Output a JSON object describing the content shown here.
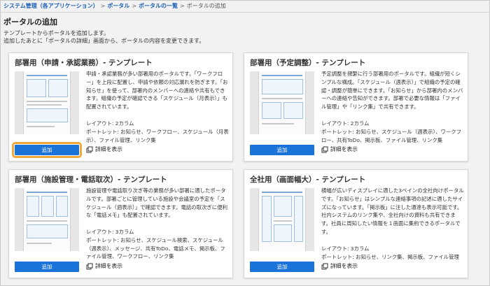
{
  "breadcrumb": {
    "items": [
      "システム管理（各アプリケーション）",
      "ポータル",
      "ポータルの一覧"
    ],
    "separator": ">",
    "current": "ポータルの追加"
  },
  "page": {
    "title": "ポータルの追加",
    "desc_line1": "テンプレートからポータルを追加します。",
    "desc_line2": "追加したあとに「ポータルの詳細」画面から、ポータルの内容を変更できます。"
  },
  "cards": [
    {
      "title": "部署用（申請・承認業務）- テンプレート",
      "description": "申請・承認業務が多い部署用のポータルです。「ワークフロー」を上段に配置し、申請や依頼の対応漏れを防ぎます。「お知らせ」を使って、部署内のメンバーへの連絡や共有もできます。組織の予定が確認できる「スケジュール（月表示）」も配置されています。",
      "layout": "レイアウト: 2カラム",
      "portlets": "ポートレット: お知らせ、ワークフロー、スケジュール（月表示）、ファイル管理、リンク集",
      "add_label": "追加",
      "detail_label": "詳細を表示"
    },
    {
      "title": "部署用（予定調整）- テンプレート",
      "description": "予定調整を頻繁に行う部署用のポータルです。組織が短くシンプルな構成。「スケジュール（週表示）」で組織の予定の確認・調整が簡単にできます。「お知らせ」から部署内のメンバーへの連絡や告知ができます。部署で必要な情報は「ファイル管理」や「リンク集」で共有できます。",
      "layout": "レイアウト: 2カラム",
      "portlets": "ポートレット: お知らせ、スケジュール（週表示）、ワークフロー、共有ToDo、掲示板、ファイル管理、リンク集",
      "add_label": "追加",
      "detail_label": "詳細を表示"
    },
    {
      "title": "部署用（施設管理・電話取次）- テンプレート",
      "description": "施設管理や電話取り次ぎ等の業務が多い部署に適したポータルです。部署ごとに管理している施設や会議室の予定を「スケジュール（週表示）」で確認できます。電話の取次ぎに便利な「電話メモ」も配置されています。",
      "layout": "レイアウト: 3カラム",
      "portlets": "ポートレット: お知らせ、スケジュール検索、スケジュール（週表示）、メッセージ、共有ToDo、電話メモ、掲示板、ファイル管理、ワークフロー、リンク集",
      "add_label": "追加",
      "detail_label": "詳細を表示"
    },
    {
      "title": "全社用（画面幅大）- テンプレート",
      "description": "横幅が広いディスプレイに適した3ペインの全社向けポータルです。「お知らせ」はシンプルな連絡事項の記述に適したサイズになっています。「掲示板」に注した通達も表示可能です。社内システムのリンク集や、全社向けの資料も共有できます。社員に周知したい情報を１画面に集約できるポータルです。",
      "layout": "レイアウト: 3カラム",
      "portlets": "ポートレット: お知らせ、リンク集、掲示板、ファイル管理",
      "add_label": "追加",
      "detail_label": "詳細を表示"
    }
  ],
  "colors": {
    "link": "#1a5fb4",
    "button": "#1a73d9",
    "focus": "#f2a93b"
  },
  "icons": {
    "zoom": "zoom-in-icon",
    "detail": "open-window-icon"
  }
}
